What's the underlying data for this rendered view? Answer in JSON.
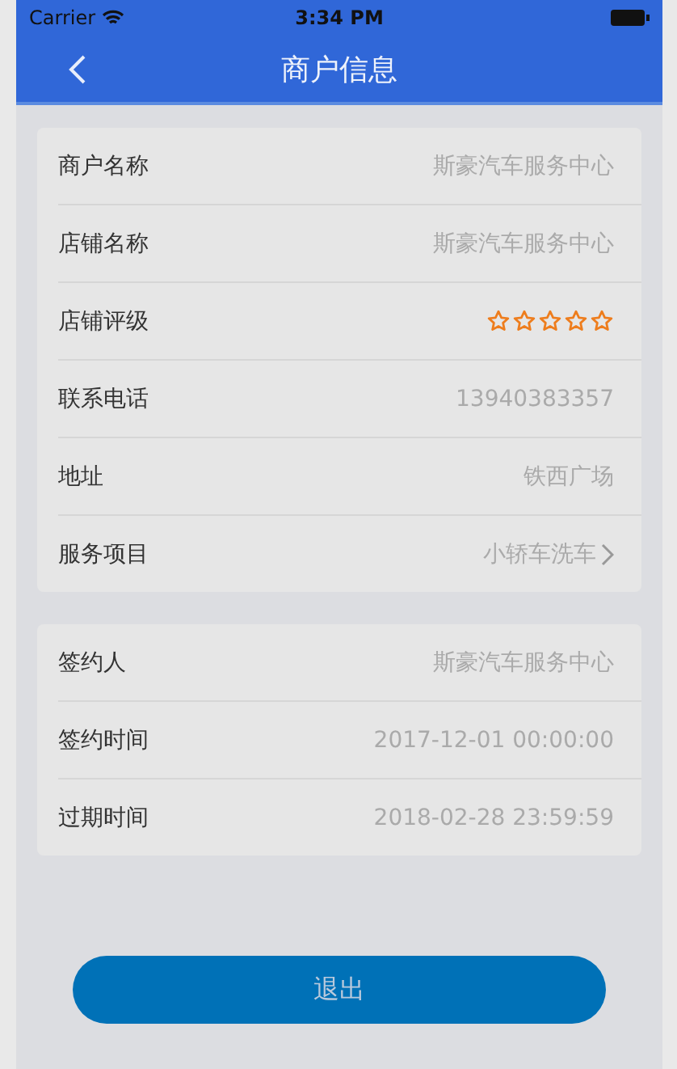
{
  "status_bar": {
    "carrier": "Carrier",
    "time": "3:34 PM"
  },
  "nav": {
    "title": "商户信息"
  },
  "sections": [
    {
      "rows": [
        {
          "kind": "text",
          "label": "商户名称",
          "value": "斯豪汽车服务中心"
        },
        {
          "kind": "text",
          "label": "店铺名称",
          "value": "斯豪汽车服务中心"
        },
        {
          "kind": "stars",
          "label": "店铺评级",
          "stars": 0
        },
        {
          "kind": "text",
          "label": "联系电话",
          "value": "13940383357"
        },
        {
          "kind": "text",
          "label": "地址",
          "value": "铁西广场"
        },
        {
          "kind": "link",
          "label": "服务项目",
          "value": "小轿车洗车"
        }
      ]
    },
    {
      "rows": [
        {
          "kind": "text",
          "label": "签约人",
          "value": "斯豪汽车服务中心"
        },
        {
          "kind": "text",
          "label": "签约时间",
          "value": "2017-12-01 00:00:00"
        },
        {
          "kind": "text",
          "label": "过期时间",
          "value": "2018-02-28 23:59:59"
        }
      ]
    }
  ],
  "logout_button": "退出"
}
